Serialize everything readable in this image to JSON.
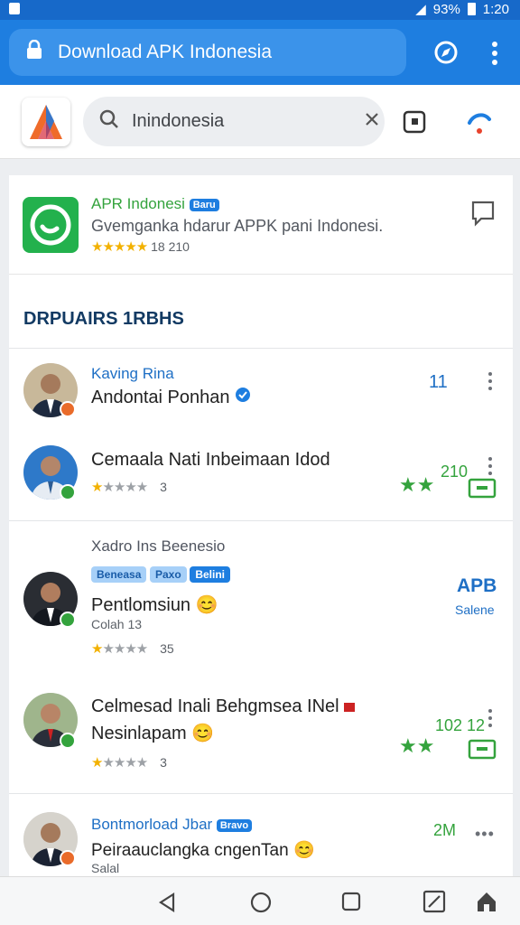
{
  "status_bar": {
    "battery": "93%",
    "time": "1:20"
  },
  "browser": {
    "url_title": "Download APK Indonesia"
  },
  "search": {
    "value": "Inindonesia",
    "placeholder": "Inindonesia"
  },
  "featured": {
    "title": "APR Indonesi",
    "badge": "Baru",
    "subtitle": "Gvemganka hdarur APPK pani Indonesi.",
    "rating_text": "18 210"
  },
  "section": {
    "title": "DRPUAIRS 1RBHS"
  },
  "items": [
    {
      "name_top": "Kaving Rina",
      "name": "Andontai Ponhan",
      "count": "11"
    },
    {
      "name": "Cemaala Nati Inbeimaan Idod",
      "meta": "3",
      "count": "210"
    },
    {
      "header": "Xadro Ins Beenesio",
      "tags": [
        "Beneasa",
        "Paxo",
        "Belini"
      ],
      "name": "Pentlomsiun",
      "sub": "Colah 13",
      "meta": "35",
      "label": "APB",
      "label_sub": "Salene"
    },
    {
      "name": "Celmesad Inali Behgmsea INel",
      "name2": "Nesinlapam",
      "meta": "3",
      "count": "102 12"
    },
    {
      "name": "Bontmorload Jbar",
      "badge": "Bravo",
      "name2": "Peiraauclangka cngenTan",
      "sub": "Salal",
      "count": "2M"
    }
  ],
  "colors": {
    "accent": "#1e7ee0",
    "green": "#34a33d",
    "star": "#f2b100"
  }
}
